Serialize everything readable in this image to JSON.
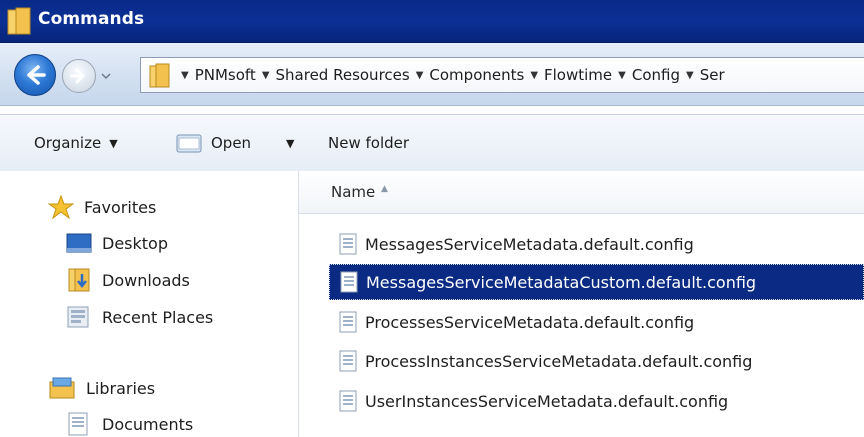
{
  "window": {
    "title": "Commands"
  },
  "address": {
    "crumbs": [
      "PNMsoft",
      "Shared Resources",
      "Components",
      "Flowtime",
      "Config",
      "Ser"
    ]
  },
  "toolbar": {
    "organize_label": "Organize",
    "open_label": "Open",
    "new_folder_label": "New folder"
  },
  "sidebar": {
    "favorites_label": "Favorites",
    "favorites": [
      "Desktop",
      "Downloads",
      "Recent Places"
    ],
    "libraries_label": "Libraries",
    "libraries": [
      "Documents"
    ]
  },
  "list": {
    "column_name": "Name",
    "selected_index": 1,
    "files": [
      "MessagesServiceMetadata.default.config",
      "MessagesServiceMetadataCustom.default.config",
      "ProcessesServiceMetadata.default.config",
      "ProcessInstancesServiceMetadata.default.config",
      "UserInstancesServiceMetadata.default.config"
    ]
  },
  "colors": {
    "title_bar": "#0a2a88",
    "selection": "#0b2a83",
    "folder": "#f2c14e"
  }
}
